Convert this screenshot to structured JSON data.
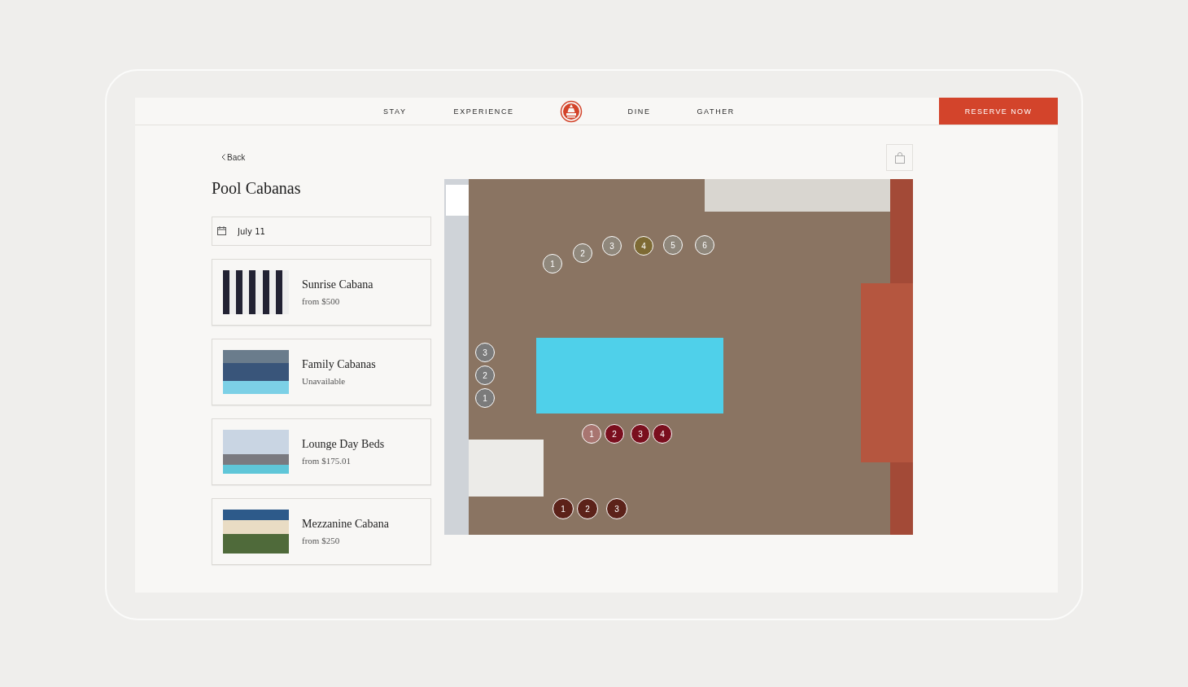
{
  "nav": {
    "links_left": [
      "STAY",
      "EXPERIENCE"
    ],
    "links_right": [
      "DINE",
      "GATHER"
    ],
    "cta": "RESERVE NOW"
  },
  "back": "Back",
  "title": "Pool Cabanas",
  "date_field": {
    "value": "July 11"
  },
  "options": [
    {
      "name": "Sunrise Cabana",
      "price": "from $500"
    },
    {
      "name": "Family Cabanas",
      "price": "Unavailable"
    },
    {
      "name": "Lounge Day Beds",
      "price": "from $175.01"
    },
    {
      "name": "Mezzanine Cabana",
      "price": "from $250"
    }
  ],
  "map": {
    "pin_groups": [
      {
        "pins": [
          {
            "label": "1",
            "color": "#8f877b"
          },
          {
            "label": "2",
            "color": "#8f877b"
          },
          {
            "label": "3",
            "color": "#8f877b"
          },
          {
            "label": "4",
            "color": "#7d6a34"
          },
          {
            "label": "5",
            "color": "#8f877b"
          },
          {
            "label": "6",
            "color": "#8f877b"
          }
        ]
      },
      {
        "pins": [
          {
            "label": "3",
            "color": "#7b7b7b"
          },
          {
            "label": "2",
            "color": "#7b7b7b"
          },
          {
            "label": "1",
            "color": "#7b7b7b"
          }
        ]
      },
      {
        "pins": [
          {
            "label": "1",
            "color": "#a87570"
          },
          {
            "label": "2",
            "color": "#7a0f1e"
          },
          {
            "label": "3",
            "color": "#7a0f1e"
          },
          {
            "label": "4",
            "color": "#7a0f1e"
          }
        ]
      },
      {
        "pins": [
          {
            "label": "1",
            "color": "#5c2219"
          },
          {
            "label": "2",
            "color": "#5c2219"
          },
          {
            "label": "3",
            "color": "#5c2219"
          }
        ]
      }
    ]
  }
}
